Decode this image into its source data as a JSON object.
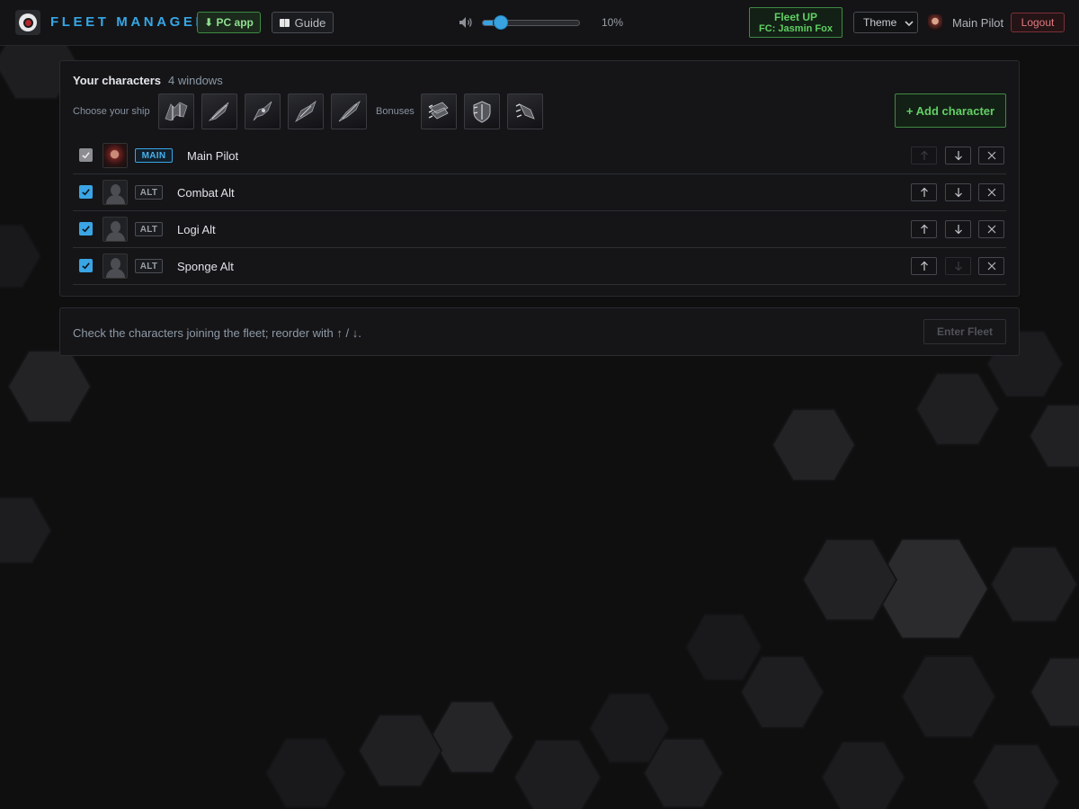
{
  "navbar": {
    "brand": "FLEET MANAGER",
    "pc_app_label": "⬇ PC app",
    "guide_label": "Guide",
    "volume": {
      "value": 10,
      "label": "10%"
    },
    "fleet_status": {
      "title": "Fleet UP",
      "fc": "FC: Jasmin Fox"
    },
    "theme_label": "Theme",
    "user_name": "Main Pilot",
    "logout_label": "Logout"
  },
  "characters_panel": {
    "title": "Your characters",
    "count": "4 windows",
    "ship_label": "Choose your ship",
    "bonus_label": "Bonuses",
    "ships": [
      "ship-1-icon",
      "ship-2-icon",
      "ship-3-icon",
      "ship-4-icon",
      "ship-5-icon"
    ],
    "bonuses": [
      "bonus-1-icon",
      "bonus-2-icon",
      "bonus-3-icon"
    ],
    "add_label": "+ Add character",
    "rows": [
      {
        "name": "Main Pilot",
        "tag": "MAIN",
        "checked": true,
        "check_disabled": true,
        "up_disabled": true,
        "down_disabled": false
      },
      {
        "name": "Combat Alt",
        "tag": "ALT",
        "checked": true,
        "check_disabled": false,
        "up_disabled": false,
        "down_disabled": false
      },
      {
        "name": "Logi Alt",
        "tag": "ALT",
        "checked": true,
        "check_disabled": false,
        "up_disabled": false,
        "down_disabled": false
      },
      {
        "name": "Sponge Alt",
        "tag": "ALT",
        "checked": true,
        "check_disabled": false,
        "up_disabled": false,
        "down_disabled": true
      }
    ]
  },
  "footer": {
    "hint": "Check the characters joining the fleet; reorder with ↑ / ↓.",
    "enter_label": "Enter Fleet"
  },
  "colors": {
    "accent": "#3aa5e5",
    "success": "#5fcf63",
    "danger": "#e17a80",
    "background": "#0f0f10"
  }
}
